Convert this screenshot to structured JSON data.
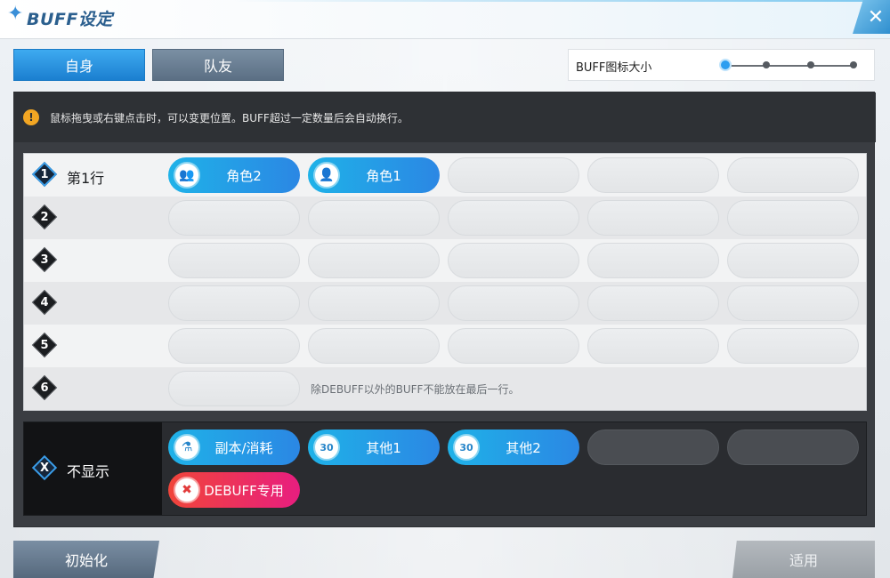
{
  "window": {
    "title": "BUFF设定",
    "close_symbol": "✕"
  },
  "tabs": [
    {
      "label": "自身",
      "active": true
    },
    {
      "label": "队友",
      "active": false
    }
  ],
  "size_setting": {
    "label": "BUFF图标大小",
    "steps": 4,
    "selected_index": 0
  },
  "notice": {
    "icon": "info-icon",
    "text": "鼠标拖曳或右键点击时，可以变更位置。BUFF超过一定数量后会自动换行。"
  },
  "rows": [
    {
      "number": "1",
      "name": "第1行",
      "active": true,
      "items": [
        {
          "label": "角色2",
          "icon": "party-icon",
          "icon_glyph": "👥"
        },
        {
          "label": "角色1",
          "icon": "person-icon",
          "icon_glyph": "👤"
        }
      ]
    },
    {
      "number": "2",
      "name": "",
      "active": false,
      "items": []
    },
    {
      "number": "3",
      "name": "",
      "active": false,
      "items": []
    },
    {
      "number": "4",
      "name": "",
      "active": false,
      "items": []
    },
    {
      "number": "5",
      "name": "",
      "active": false,
      "items": []
    },
    {
      "number": "6",
      "name": "",
      "active": false,
      "items": [],
      "note": "除DEBUFF以外的BUFF不能放在最后一行。"
    }
  ],
  "hidden_section": {
    "badge": "X",
    "name": "不显示",
    "items": [
      {
        "label": "副本/消耗",
        "icon": "flask-icon",
        "icon_glyph": "⚗",
        "color": "blue"
      },
      {
        "label": "其他1",
        "icon": "timer-30-icon",
        "icon_glyph": "30",
        "color": "blue"
      },
      {
        "label": "其他2",
        "icon": "timer-30-icon",
        "icon_glyph": "30",
        "color": "blue"
      },
      {
        "label": "DEBUFF专用",
        "icon": "debuff-icon",
        "icon_glyph": "✖",
        "color": "red"
      }
    ]
  },
  "buttons": {
    "reset": "初始化",
    "apply": "适用"
  },
  "colors": {
    "accent_blue": "#2b87e4",
    "debuff_red": "#e81e7f",
    "panel_dark": "#3a3d42",
    "notice_icon": "#f2a623"
  }
}
